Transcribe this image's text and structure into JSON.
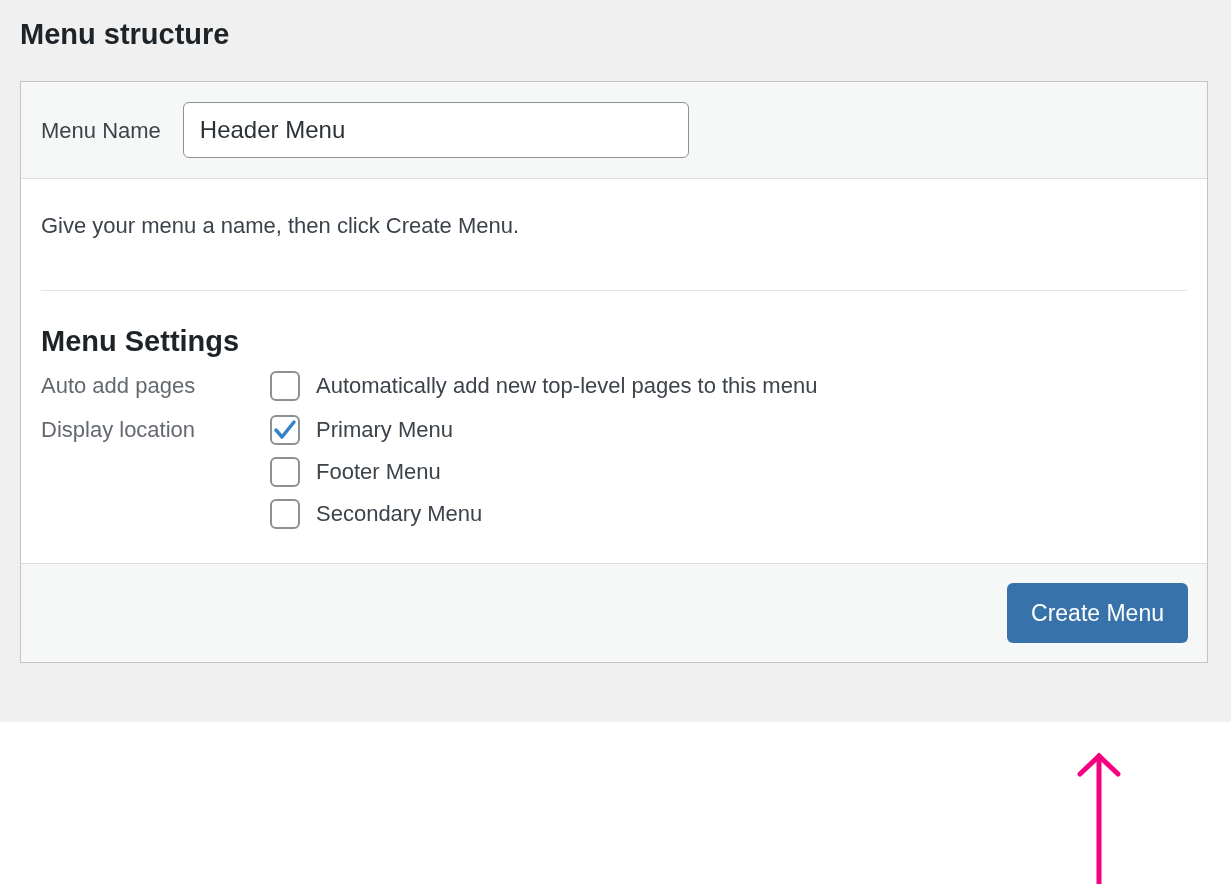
{
  "heading": "Menu structure",
  "menu_name": {
    "label": "Menu Name",
    "value": "Header Menu"
  },
  "description": "Give your menu a name, then click Create Menu.",
  "settings": {
    "title": "Menu Settings",
    "groups": [
      {
        "label": "Auto add pages",
        "options": [
          {
            "label": "Automatically add new top-level pages to this menu",
            "checked": false
          }
        ]
      },
      {
        "label": "Display location",
        "options": [
          {
            "label": "Primary Menu",
            "checked": true
          },
          {
            "label": "Footer Menu",
            "checked": false
          },
          {
            "label": "Secondary Menu",
            "checked": false
          }
        ]
      }
    ]
  },
  "footer": {
    "button": "Create Menu"
  }
}
